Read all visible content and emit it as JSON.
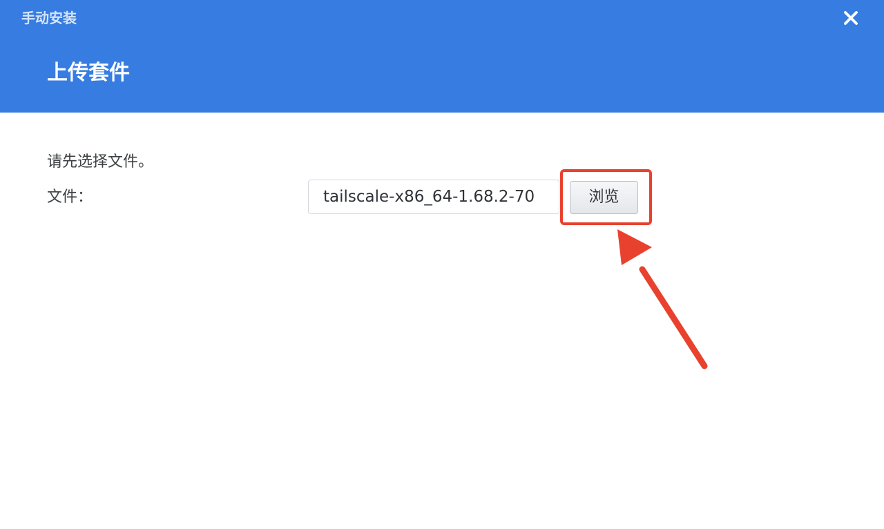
{
  "dialog": {
    "title": "手动安装",
    "close_icon": "close-icon",
    "section_title": "上传套件",
    "instruction": "请先选择文件。",
    "file_label": "文件：",
    "file_value": "tailscale-x86_64-1.68.2-70",
    "browse_label": "浏览"
  },
  "colors": {
    "accent": "#377ce0",
    "highlight": "#e8422e"
  },
  "annotations": {
    "highlight_target": "browse-button",
    "arrow_icon": "arrow-icon"
  }
}
